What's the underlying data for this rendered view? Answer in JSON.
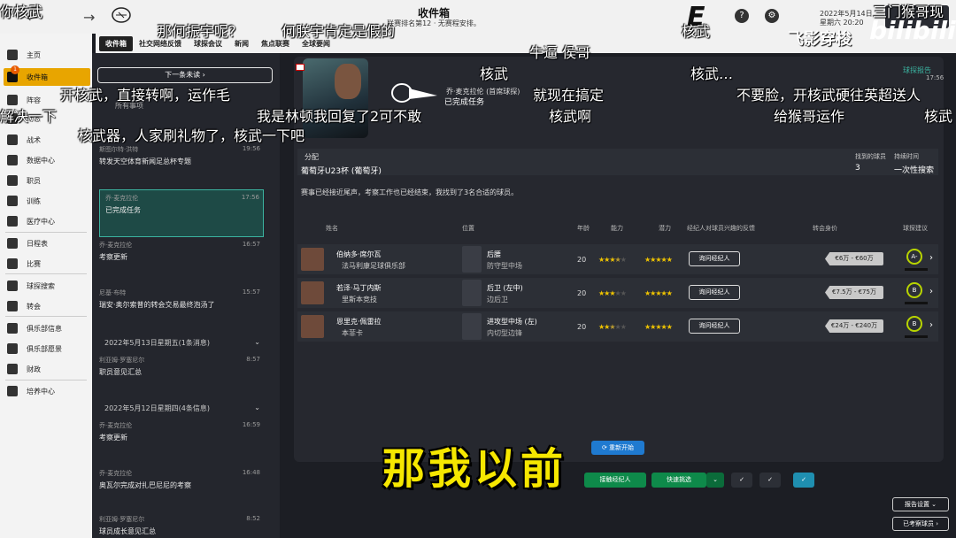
{
  "topbar": {
    "title": "收件箱",
    "subtitle": "联赛排名第12 · 无赛程安排。",
    "date": "2022年5月14日",
    "time": "星期六 20:20"
  },
  "subtabs": [
    "收件箱",
    "社交网络反馈",
    "球探会议",
    "新闻",
    "焦点联赛",
    "全球要闻"
  ],
  "sidebar": {
    "badge": "1",
    "items": [
      "主页",
      "收件箱",
      "阵容",
      "动态",
      "战术",
      "数据中心",
      "职员",
      "训练",
      "医疗中心",
      "日程表",
      "比赛",
      "球探搜索",
      "转会",
      "俱乐部信息",
      "俱乐部愿景",
      "财政",
      "培养中心"
    ]
  },
  "list": {
    "next_unread": "下一条未读",
    "search_placeholder": "所有事项",
    "messages_top": [
      {
        "from": "斯图尔特·洪特",
        "subject": "转发天空体育新闻足总杯专题",
        "time": "19:56"
      },
      {
        "from": "乔·麦克拉伦",
        "subject": "已完成任务",
        "time": "17:56"
      },
      {
        "from": "乔·麦克拉伦",
        "subject": "考察更新",
        "time": "16:57"
      },
      {
        "from": "尼基·布特",
        "subject": "瑞安·奥尔索普的转会交易最终泡汤了",
        "time": "15:57"
      }
    ],
    "day1": "2022年5月13日星期五(1条消息)",
    "day1_messages": [
      {
        "from": "利亚姆·罗塞尼尔",
        "subject": "职员意见汇总",
        "time": "8:57"
      }
    ],
    "day2": "2022年5月12日星期四(4条信息)",
    "day2_messages": [
      {
        "from": "乔·麦克拉伦",
        "subject": "考察更新",
        "time": "16:59"
      },
      {
        "from": "乔·麦克拉伦",
        "subject": "奥瓦尔完成对扎巴尼尼的考察",
        "time": "16:48"
      },
      {
        "from": "利亚姆·罗塞尼尔",
        "subject": "球员成长意见汇总",
        "time": "8:52"
      }
    ]
  },
  "report": {
    "scout_name": "乔·麦克拉伦 (首席球探)",
    "status": "已完成任务",
    "tag": "球探报告",
    "time": "17:56",
    "assign_label": "分配",
    "assign_value": "葡萄牙U23杯 (葡萄牙)",
    "found_label": "找到的球员",
    "found_value": "3",
    "duration_label": "持续时间",
    "duration_value": "一次性搜索",
    "description": "赛事已经接近尾声，考察工作也已经结束，我找到了3名合适的球员。",
    "headers": [
      "姓名",
      "位置",
      "年龄",
      "能力",
      "潜力",
      "经纪人对球员兴趣的反馈",
      "转会身价",
      "球探建议"
    ],
    "players": [
      {
        "name": "伯纳多·席尔瓦",
        "club": "法马利康足球俱乐部",
        "pos": "后腰",
        "role": "防守型中场",
        "age": "20",
        "ability": 3.5,
        "potential": 5,
        "agent": "询问经纪人",
        "value": "€6万 - €60万",
        "grade": "A-"
      },
      {
        "name": "若泽·马丁内斯",
        "club": "里斯本竞技",
        "pos": "后卫 (左中)",
        "role": "边后卫",
        "age": "20",
        "ability": 3,
        "potential": 5,
        "agent": "询问经纪人",
        "value": "€7.5万 - €75万",
        "grade": "B"
      },
      {
        "name": "恩里克·佩雷拉",
        "club": "本菲卡",
        "pos": "进攻型中场 (左)",
        "role": "内切型边锋",
        "age": "20",
        "ability": 2.5,
        "potential": 5,
        "agent": "询问经纪人",
        "value": "€24万 - €240万",
        "grade": "B"
      }
    ],
    "restart": "重新开始",
    "contact_agent": "接触经纪人",
    "quick_pick": "快速挑选",
    "report_settings": "报告设置",
    "scouted_players": "已考察球员"
  },
  "overlay": {
    "danmaku": [
      "你核武",
      "那何振宇呢？",
      "何朕宇肯定是假的",
      "核武",
      "三门猴哥现",
      "牛逼  侯哥",
      "核武",
      "核武…",
      "开核武，直接转啊，运作毛",
      "就现在搞定",
      "不要脸，开核武硬往英超送人",
      "解决一下",
      "我是林顿我回复了2可不敢",
      "核武啊",
      "给猴哥运作",
      "核武",
      "核武器，人家刷礼物了，核武一下吧"
    ],
    "subtitle": "那我以前",
    "watermark": "飞影穿梭",
    "bili": "bilibili"
  }
}
